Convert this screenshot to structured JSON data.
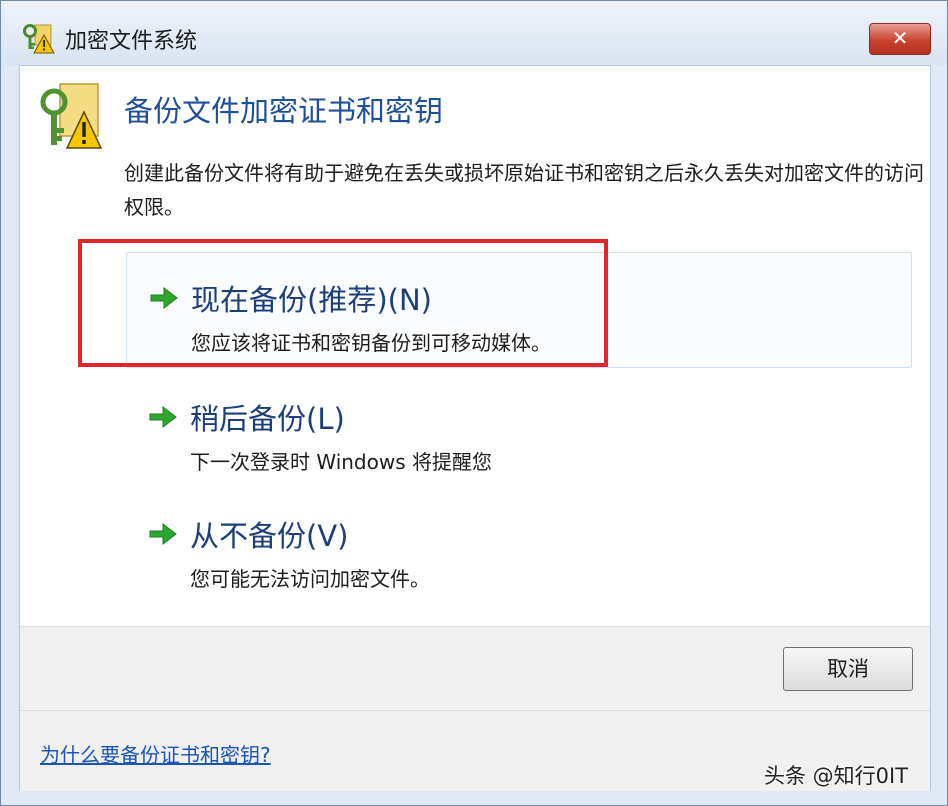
{
  "window": {
    "title": "加密文件系统",
    "close_glyph": "✕"
  },
  "dialog": {
    "heading": "备份文件加密证书和密钥",
    "description": "创建此备份文件将有助于避免在丢失或损坏原始证书和密钥之后永久丢失对加密文件的访问权限。"
  },
  "options": [
    {
      "title": "现在备份(推荐)(N)",
      "subtitle": "您应该将证书和密钥备份到可移动媒体。",
      "icon": "green-arrow-icon"
    },
    {
      "title": "稍后备份(L)",
      "subtitle": "下一次登录时 Windows 将提醒您",
      "icon": "green-arrow-icon"
    },
    {
      "title": "从不备份(V)",
      "subtitle": "您可能无法访问加密文件。",
      "icon": "green-arrow-icon"
    }
  ],
  "buttons": {
    "cancel": "取消"
  },
  "footer": {
    "help_link": "为什么要备份证书和密钥?"
  },
  "watermark": "头条 @知行0IT",
  "colors": {
    "heading": "#1e4f99",
    "link": "#1a55b5",
    "highlight_border": "#e0262b",
    "arrow": "#2fa52f"
  }
}
